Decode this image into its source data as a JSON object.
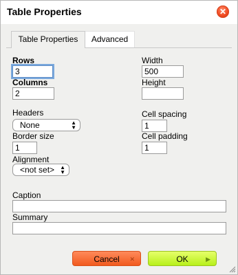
{
  "dialog": {
    "title": "Table Properties"
  },
  "tabs": [
    "Table Properties",
    "Advanced"
  ],
  "fields": {
    "rows": {
      "label": "Rows",
      "value": "3"
    },
    "columns": {
      "label": "Columns",
      "value": "2"
    },
    "width": {
      "label": "Width",
      "value": "500"
    },
    "height": {
      "label": "Height",
      "value": ""
    },
    "headers": {
      "label": "Headers",
      "value": "None"
    },
    "cell_spacing": {
      "label": "Cell spacing",
      "value": "1"
    },
    "border_size": {
      "label": "Border size",
      "value": "1"
    },
    "cell_padding": {
      "label": "Cell padding",
      "value": "1"
    },
    "alignment": {
      "label": "Alignment",
      "value": "<not set>"
    },
    "caption": {
      "label": "Caption",
      "value": ""
    },
    "summary": {
      "label": "Summary",
      "value": ""
    }
  },
  "buttons": {
    "cancel": "Cancel",
    "ok": "OK"
  },
  "colors": {
    "cancel": "#f15a1e",
    "ok": "#b7f01a",
    "close": "#f04a20"
  }
}
